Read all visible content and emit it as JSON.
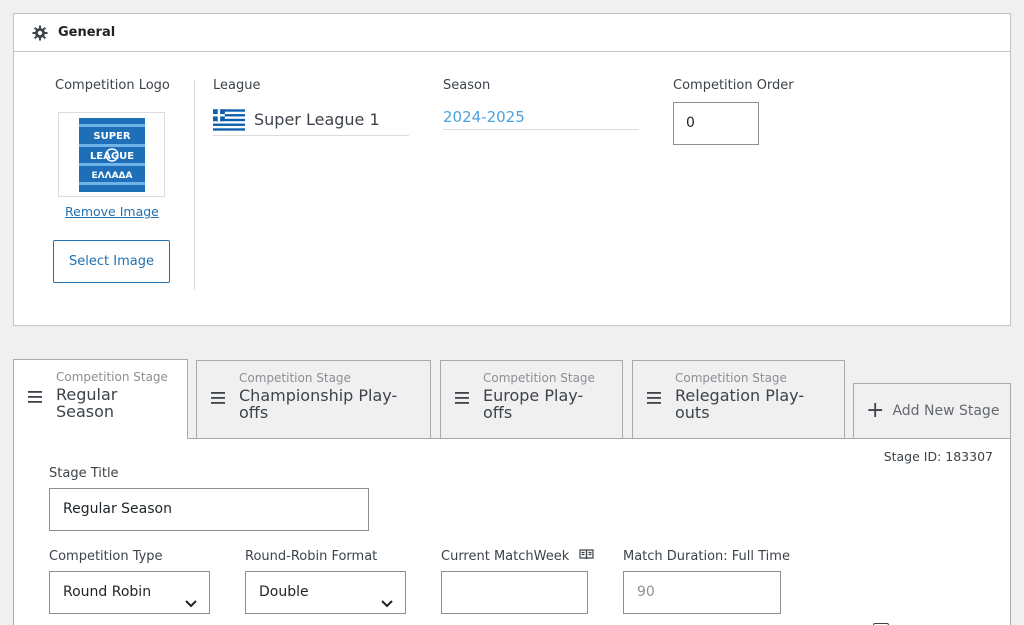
{
  "general": {
    "title": "General",
    "logo_label": "Competition Logo",
    "logo_text": [
      "SUPER",
      "LEAGUE",
      "ΕΛΛΑΔΑ"
    ],
    "remove_image": "Remove Image",
    "select_image": "Select Image",
    "league_label": "League",
    "league_value": "Super League 1",
    "season_label": "Season",
    "season_value": "2024-2025",
    "order_label": "Competition Order",
    "order_value": "0"
  },
  "tabs": [
    {
      "small": "Competition Stage",
      "line1": "Regular",
      "line2": "Season",
      "active": true
    },
    {
      "small": "Competition Stage",
      "line1": "Championship Play-",
      "line2": "offs",
      "active": false
    },
    {
      "small": "Competition Stage",
      "line1": "Europe Play-",
      "line2": "offs",
      "active": false
    },
    {
      "small": "Competition Stage",
      "line1": "Relegation Play-",
      "line2": "outs",
      "active": false
    }
  ],
  "add_stage": "Add New Stage",
  "stage": {
    "id_text": "Stage ID: 183307",
    "title_label": "Stage Title",
    "title_value": "Regular Season",
    "type_label": "Competition Type",
    "type_value": "Round Robin",
    "format_label": "Round-Robin Format",
    "format_value": "Double",
    "matchweek_label": "Current MatchWeek",
    "matchweek_value": "",
    "duration_label": "Match Duration: Full Time",
    "duration_placeholder": "90"
  },
  "colors": {
    "link": "#2271b1",
    "season": "#4aa3df",
    "greek_blue": "#0d5eaf",
    "logo_blue": "#1e6fb8"
  }
}
